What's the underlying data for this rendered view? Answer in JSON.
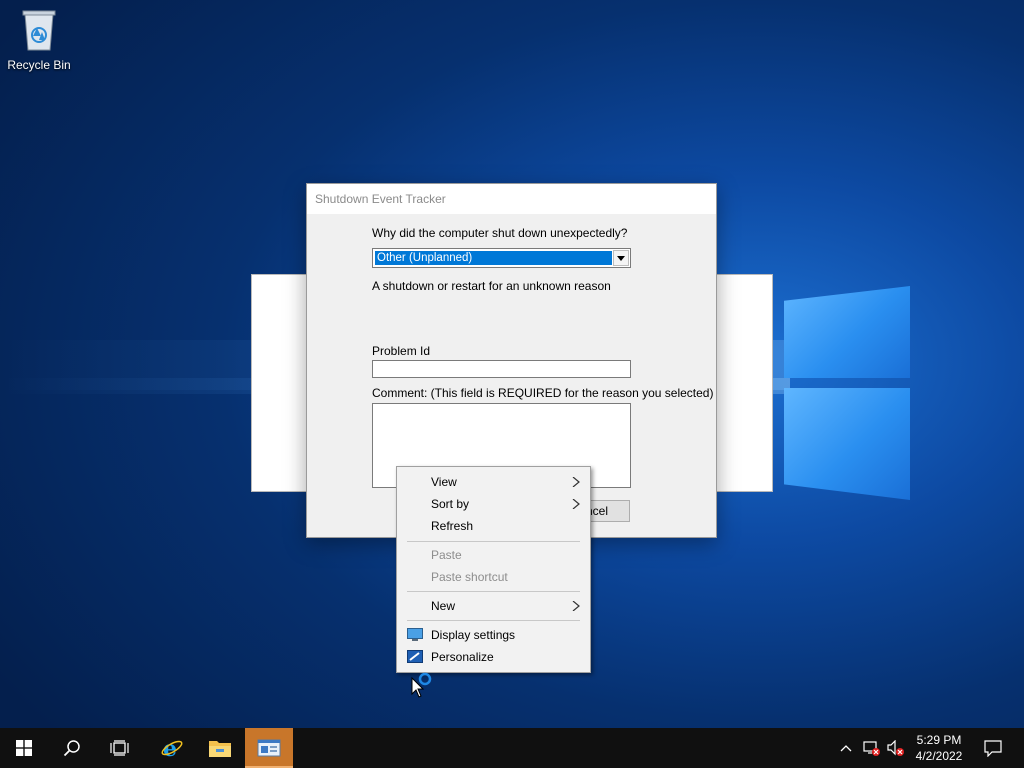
{
  "desktop": {
    "icons": [
      {
        "label": "Recycle Bin",
        "icon": "recycle-bin-icon"
      }
    ]
  },
  "dialog": {
    "title": "Shutdown Event Tracker",
    "question": "Why did the computer shut down unexpectedly?",
    "reason_selected": "Other (Unplanned)",
    "reason_description": "A shutdown or restart for an unknown reason",
    "problem_id_label": "Problem Id",
    "problem_id_value": "",
    "comment_label": "Comment: (This field is REQUIRED for the reason you selected)",
    "comment_value": "",
    "cancel_label": "ncel"
  },
  "context_menu": {
    "items": [
      {
        "label": "View",
        "submenu": true,
        "enabled": true
      },
      {
        "label": "Sort by",
        "submenu": true,
        "enabled": true
      },
      {
        "label": "Refresh",
        "submenu": false,
        "enabled": true
      },
      {
        "label": "Paste",
        "submenu": false,
        "enabled": false
      },
      {
        "label": "Paste shortcut",
        "submenu": false,
        "enabled": false
      },
      {
        "label": "New",
        "submenu": true,
        "enabled": true
      },
      {
        "label": "Display settings",
        "submenu": false,
        "enabled": true,
        "icon": "display-settings-icon"
      },
      {
        "label": "Personalize",
        "submenu": false,
        "enabled": true,
        "icon": "personalize-icon"
      }
    ]
  },
  "taskbar": {
    "buttons": [
      {
        "name": "start",
        "icon": "windows-start-icon"
      },
      {
        "name": "search",
        "icon": "search-icon"
      },
      {
        "name": "task-view",
        "icon": "task-view-icon"
      },
      {
        "name": "internet-explorer",
        "icon": "internet-explorer-icon"
      },
      {
        "name": "file-explorer",
        "icon": "folder-icon"
      },
      {
        "name": "server-manager",
        "icon": "server-manager-icon",
        "active": true
      }
    ],
    "tray": {
      "icons": [
        "chevron-up-icon",
        "network-error-icon",
        "volume-muted-icon"
      ],
      "time": "5:29 PM",
      "date": "4/2/2022",
      "notifications_icon": "action-center-icon"
    }
  },
  "colors": {
    "selection": "#0078d7",
    "taskbar": "#101010",
    "active_taskbar_button": "#c8762a"
  }
}
